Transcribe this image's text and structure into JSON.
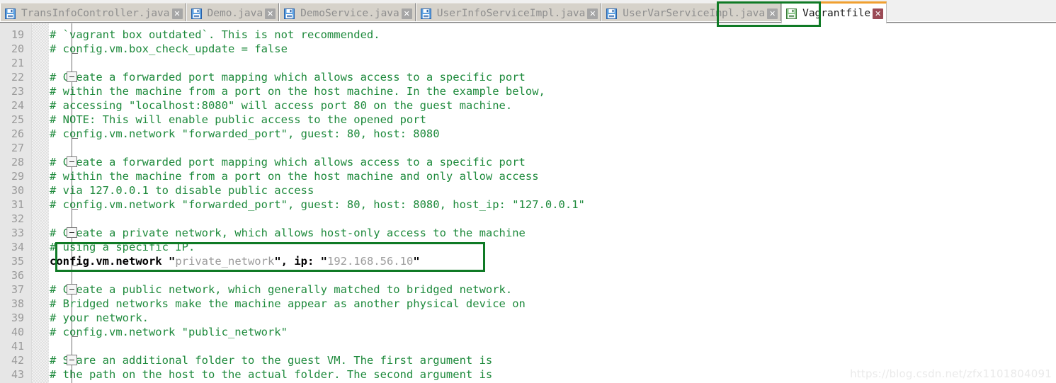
{
  "window": {
    "kind": "code-editor",
    "accent_orange": "#f0a030",
    "annotation_green": "#0f7a25",
    "comment_green": "#1e8a3c",
    "string_gray": "#9c9c9c",
    "gutter_bg": "#e6e6e6",
    "tab_bg": "#d6d2ca"
  },
  "tabs": [
    {
      "label": "TransInfoController.java",
      "icon": "save-floppy-icon",
      "close_icon": "close-icon",
      "active": false
    },
    {
      "label": "Demo.java",
      "icon": "save-floppy-icon",
      "close_icon": "close-icon",
      "active": false
    },
    {
      "label": "DemoService.java",
      "icon": "save-floppy-icon",
      "close_icon": "close-icon",
      "active": false
    },
    {
      "label": "UserInfoServiceImpl.java",
      "icon": "save-floppy-icon",
      "close_icon": "close-icon",
      "active": false
    },
    {
      "label": "UserVarServiceImpl.java",
      "icon": "save-floppy-icon",
      "close_icon": "close-icon",
      "active": false
    },
    {
      "label": "Vagrantfile",
      "icon": "save-floppy-icon",
      "close_icon": "close-icon",
      "active": true
    }
  ],
  "close_glyph": "✕",
  "editor": {
    "first_line": 19,
    "last_line": 43,
    "fold_boxes": [
      22,
      28,
      33,
      37,
      42
    ],
    "fold_ticks": [
      20,
      26,
      31,
      35,
      40
    ],
    "lines": [
      {
        "n": 19,
        "segments": [
          {
            "t": "# `vagrant box outdated`. This is not recommended.",
            "c": "cmt"
          }
        ]
      },
      {
        "n": 20,
        "segments": [
          {
            "t": "# config.vm.box_check_update = false",
            "c": "cmt"
          }
        ]
      },
      {
        "n": 21,
        "segments": [
          {
            "t": "",
            "c": "cmt"
          }
        ]
      },
      {
        "n": 22,
        "segments": [
          {
            "t": "# Create a forwarded port mapping which allows access to a specific port",
            "c": "cmt"
          }
        ]
      },
      {
        "n": 23,
        "segments": [
          {
            "t": "# within the machine from a port on the host machine. In the example below,",
            "c": "cmt"
          }
        ]
      },
      {
        "n": 24,
        "segments": [
          {
            "t": "# accessing \"localhost:8080\" will access port 80 on the guest machine.",
            "c": "cmt"
          }
        ]
      },
      {
        "n": 25,
        "segments": [
          {
            "t": "# NOTE: This will enable public access to the opened port",
            "c": "cmt"
          }
        ]
      },
      {
        "n": 26,
        "segments": [
          {
            "t": "# config.vm.network \"forwarded_port\", guest: 80, host: 8080",
            "c": "cmt"
          }
        ]
      },
      {
        "n": 27,
        "segments": [
          {
            "t": "",
            "c": "cmt"
          }
        ]
      },
      {
        "n": 28,
        "segments": [
          {
            "t": "# Create a forwarded port mapping which allows access to a specific port",
            "c": "cmt"
          }
        ]
      },
      {
        "n": 29,
        "segments": [
          {
            "t": "# within the machine from a port on the host machine and only allow access",
            "c": "cmt"
          }
        ]
      },
      {
        "n": 30,
        "segments": [
          {
            "t": "# via 127.0.0.1 to disable public access",
            "c": "cmt"
          }
        ]
      },
      {
        "n": 31,
        "segments": [
          {
            "t": "# config.vm.network \"forwarded_port\", guest: 80, host: 8080, host_ip: \"127.0.0.1\"",
            "c": "cmt"
          }
        ]
      },
      {
        "n": 32,
        "segments": [
          {
            "t": "",
            "c": "cmt"
          }
        ]
      },
      {
        "n": 33,
        "segments": [
          {
            "t": "# Create a private network, which allows host-only access to the machine",
            "c": "cmt"
          }
        ]
      },
      {
        "n": 34,
        "segments": [
          {
            "t": "# using a specific IP.",
            "c": "cmt"
          }
        ]
      },
      {
        "n": 35,
        "segments": [
          {
            "t": "config.vm.network ",
            "c": "kw"
          },
          {
            "t": "\"",
            "c": "strq"
          },
          {
            "t": "private_network",
            "c": "str"
          },
          {
            "t": "\", ",
            "c": "strq"
          },
          {
            "t": "ip: ",
            "c": "kw"
          },
          {
            "t": "\"",
            "c": "strq"
          },
          {
            "t": "192.168.56.10",
            "c": "str"
          },
          {
            "t": "\"",
            "c": "strq"
          }
        ]
      },
      {
        "n": 36,
        "segments": [
          {
            "t": "",
            "c": "cmt"
          }
        ]
      },
      {
        "n": 37,
        "segments": [
          {
            "t": "# Create a public network, which generally matched to bridged network.",
            "c": "cmt"
          }
        ]
      },
      {
        "n": 38,
        "segments": [
          {
            "t": "# Bridged networks make the machine appear as another physical device on",
            "c": "cmt"
          }
        ]
      },
      {
        "n": 39,
        "segments": [
          {
            "t": "# your network.",
            "c": "cmt"
          }
        ]
      },
      {
        "n": 40,
        "segments": [
          {
            "t": "# config.vm.network \"public_network\"",
            "c": "cmt"
          }
        ]
      },
      {
        "n": 41,
        "segments": [
          {
            "t": "",
            "c": "cmt"
          }
        ]
      },
      {
        "n": 42,
        "segments": [
          {
            "t": "# Share an additional folder to the guest VM. The first argument is",
            "c": "cmt"
          }
        ]
      },
      {
        "n": 43,
        "segments": [
          {
            "t": "# the path on the host to the actual folder. The second argument is",
            "c": "cmt"
          }
        ]
      }
    ]
  },
  "watermark": {
    "text": "https://blog.csdn.net/zfx1101804091"
  }
}
